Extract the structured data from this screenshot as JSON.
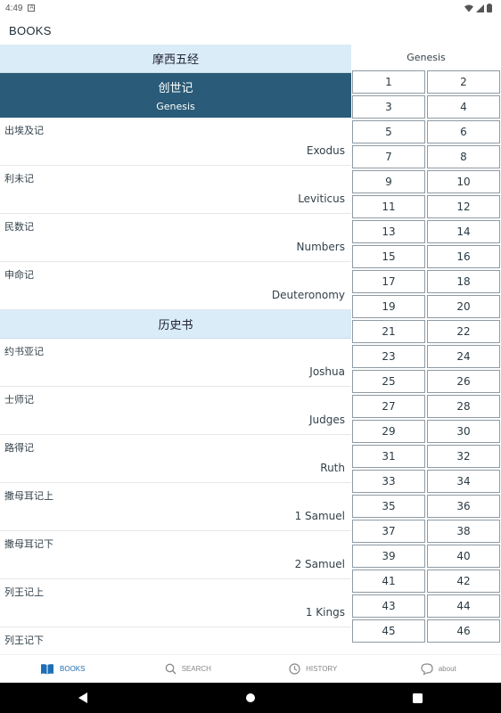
{
  "status": {
    "time": "4:49"
  },
  "app": {
    "title": "BOOKS"
  },
  "books_panel": {
    "sections": [
      {
        "header": "摩西五经",
        "selected": {
          "cn": "创世记",
          "en": "Genesis"
        },
        "items": [
          {
            "cn": "出埃及记",
            "en": "Exodus"
          },
          {
            "cn": "利未记",
            "en": "Leviticus"
          },
          {
            "cn": "民数记",
            "en": "Numbers"
          },
          {
            "cn": "申命记",
            "en": "Deuteronomy"
          }
        ]
      },
      {
        "header": "历史书",
        "items": [
          {
            "cn": "约书亚记",
            "en": "Joshua"
          },
          {
            "cn": "士师记",
            "en": "Judges"
          },
          {
            "cn": "路得记",
            "en": "Ruth"
          },
          {
            "cn": "撒母耳记上",
            "en": "1 Samuel"
          },
          {
            "cn": "撒母耳记下",
            "en": "2 Samuel"
          },
          {
            "cn": "列王记上",
            "en": "1 Kings"
          },
          {
            "cn": "列王记下",
            "en": ""
          }
        ]
      }
    ]
  },
  "chapters_panel": {
    "book_title": "Genesis",
    "chapters": [
      "1",
      "2",
      "3",
      "4",
      "5",
      "6",
      "7",
      "8",
      "9",
      "10",
      "11",
      "12",
      "13",
      "14",
      "15",
      "16",
      "17",
      "18",
      "19",
      "20",
      "21",
      "22",
      "23",
      "24",
      "25",
      "26",
      "27",
      "28",
      "29",
      "30",
      "31",
      "32",
      "33",
      "34",
      "35",
      "36",
      "37",
      "38",
      "39",
      "40",
      "41",
      "42",
      "43",
      "44",
      "45",
      "46"
    ]
  },
  "bottom_nav": {
    "books": "BOOKS",
    "search": "SEARCH",
    "history": "HISTORY",
    "about": "about"
  },
  "colors": {
    "section_header_bg": "#d9ecf7",
    "selected_bg": "#2a5b78",
    "active_nav": "#1f6fb5"
  }
}
